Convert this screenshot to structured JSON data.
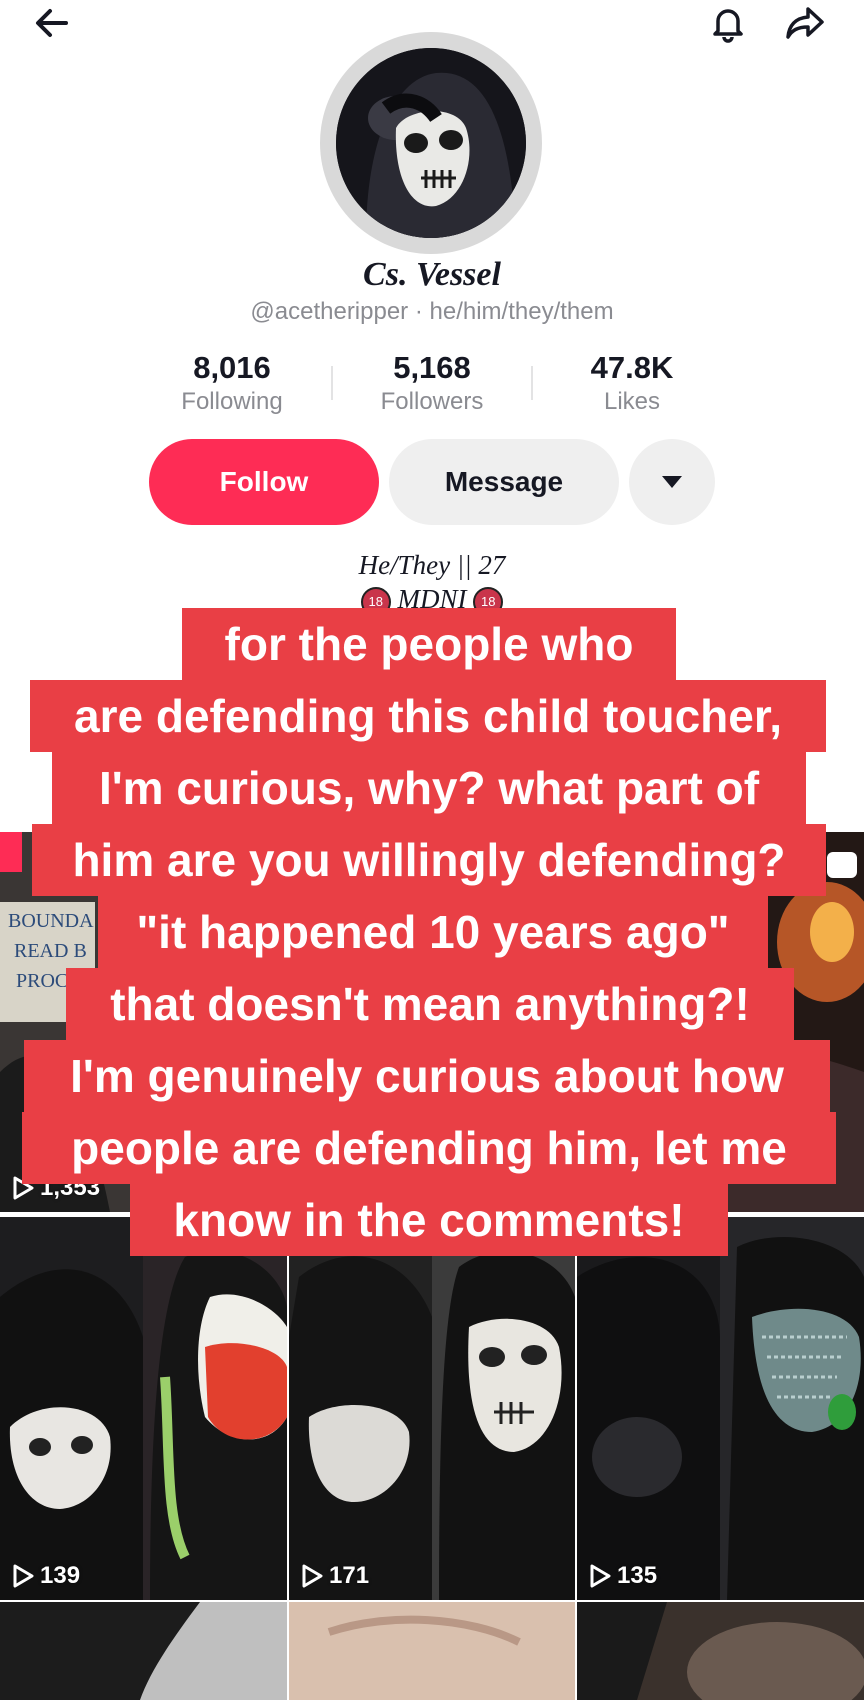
{
  "header": {
    "back_icon": "arrow-left-icon",
    "bell_icon": "bell-icon",
    "share_icon": "share-arrow-icon"
  },
  "profile": {
    "display_name": "Cs. Vessel",
    "handle_line": "@acetheripper · he/him/they/them",
    "stats": [
      {
        "value": "8,016",
        "label": "Following"
      },
      {
        "value": "5,168",
        "label": "Followers"
      },
      {
        "value": "47.8K",
        "label": "Likes"
      }
    ],
    "follow_label": "Follow",
    "message_label": "Message",
    "bio_line1": "He/They || 27",
    "bio_line2": "MDNI",
    "badge": "18"
  },
  "videos": [
    {
      "views": "1,353",
      "thumb_text": [
        "BOUNDA",
        "READ B",
        "PROC"
      ]
    },
    {
      "views": ""
    },
    {
      "views": ""
    },
    {
      "views": "139"
    },
    {
      "views": "171"
    },
    {
      "views": "135"
    }
  ],
  "overlay_caption": [
    "for the people who",
    "are defending this child toucher,",
    "I'm curious, why? what part of",
    "him are you willingly defending?",
    "\"it happened 10 years ago\"",
    "that doesn't mean anything?!",
    "I'm genuinely curious about how",
    "people are defending him, let me",
    "know in the comments!"
  ],
  "colors": {
    "follow_button": "#fe2c55",
    "caption_background": "#e93f45"
  }
}
